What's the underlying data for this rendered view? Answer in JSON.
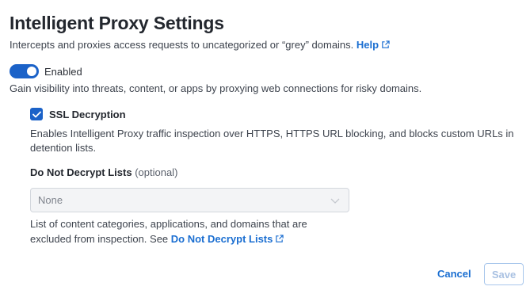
{
  "header": {
    "title": "Intelligent Proxy Settings",
    "subtitle": "Intercepts and proxies access requests to uncategorized or “grey” domains.",
    "help_link": "Help"
  },
  "toggle": {
    "label": "Enabled",
    "on": true,
    "description": "Gain visibility into threats, content, or apps by proxying web connections for risky domains."
  },
  "ssl": {
    "label": "SSL Decryption",
    "checked": true,
    "description": "Enables Intelligent Proxy traffic inspection over HTTPS, HTTPS URL blocking, and blocks custom URLs in detention lists."
  },
  "do_not_decrypt": {
    "heading": "Do Not Decrypt Lists",
    "optional": "(optional)",
    "selected": "None",
    "help_text": "List of content categories, applications, and domains that are excluded from inspection. See",
    "help_link": "Do Not Decrypt Lists"
  },
  "footer": {
    "cancel_label": "Cancel",
    "save_label": "Save"
  },
  "colors": {
    "accent": "#1b62c8",
    "link": "#1a6ed1",
    "text": "#23272e"
  },
  "icons": [
    "external-link-icon",
    "checkmark-icon",
    "chevron-down-icon"
  ]
}
